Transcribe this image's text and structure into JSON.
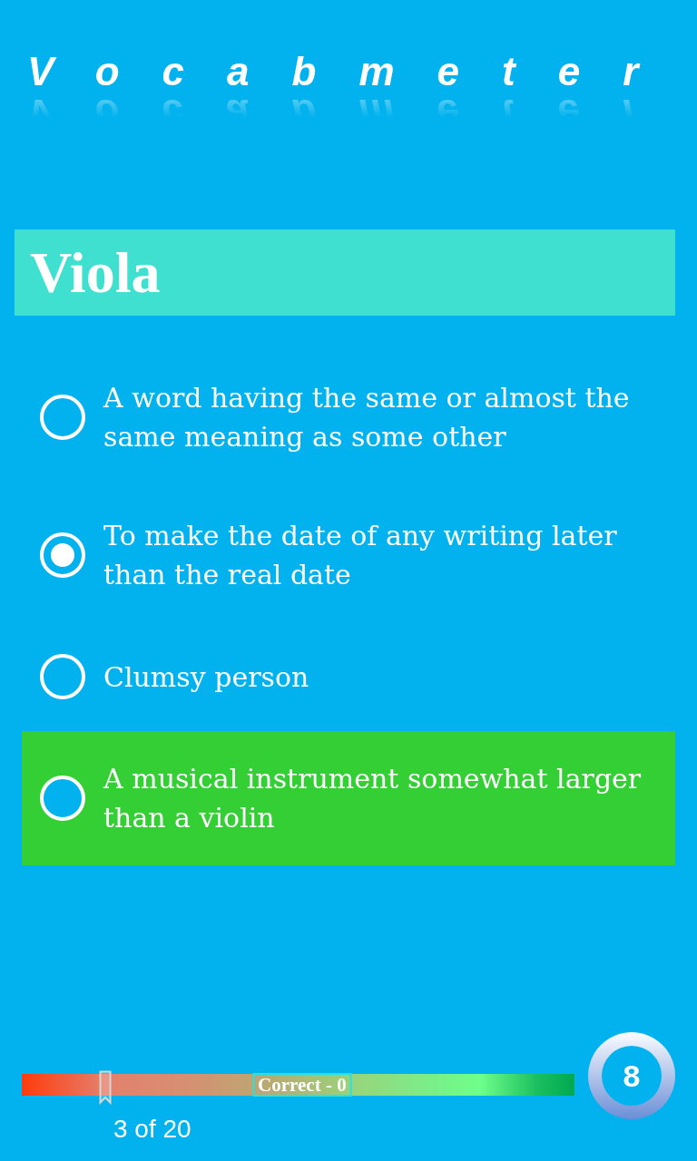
{
  "logo": {
    "text": "Vocabmeter"
  },
  "word": {
    "text": "Viola"
  },
  "options": [
    {
      "text": "A word having the same or almost the same meaning as some other",
      "selected": false,
      "correct": false
    },
    {
      "text": "To make the date of any writing later than the real date",
      "selected": true,
      "correct": false
    },
    {
      "text": "Clumsy person",
      "selected": false,
      "correct": false
    },
    {
      "text": "A musical instrument somewhat larger than a violin",
      "selected": false,
      "correct": true
    }
  ],
  "progress": {
    "level": 0.15,
    "score_label": "Correct - 0",
    "counter": "3 of 20"
  },
  "timer": {
    "count": "8"
  }
}
